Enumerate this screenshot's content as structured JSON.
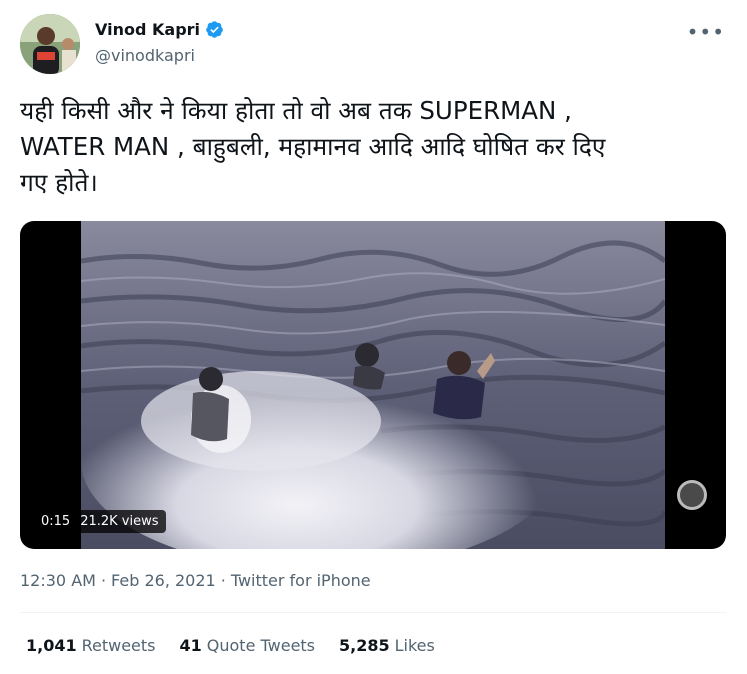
{
  "author": {
    "name": "Vinod Kapri",
    "handle": "@vinodkapri",
    "verified": true
  },
  "more_icon": "more-horizontal-icon",
  "tweet": {
    "text_line1": "यही किसी और ने किया होता तो वो अब तक SUPERMAN ,",
    "text_line2": "WATER MAN , बाहुबली, महामानव आदि आदि घोषित कर दिए",
    "text_line3": "गए होते।"
  },
  "video": {
    "time": "0:15",
    "views": "21.2K views"
  },
  "meta": {
    "time": "12:30 AM",
    "date": "Feb 26, 2021",
    "source": "Twitter for iPhone",
    "separator": "·"
  },
  "stats": [
    {
      "count": "1,041",
      "label": "Retweets"
    },
    {
      "count": "41",
      "label": "Quote Tweets"
    },
    {
      "count": "5,285",
      "label": "Likes"
    }
  ],
  "colors": {
    "text": "#0f1419",
    "secondary": "#536471",
    "verified": "#1d9bf0"
  }
}
